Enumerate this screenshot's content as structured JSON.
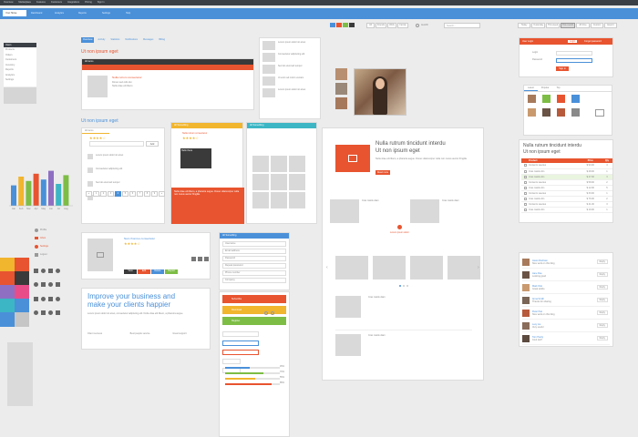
{
  "topbar": {
    "links": [
      "Overview",
      "Marketplace",
      "Features",
      "Customers",
      "Integrations",
      "Pricing",
      "Sign In"
    ],
    "tabs": [
      "Your Home",
      "Dashboard",
      "Analytics",
      "Reports",
      "Settings",
      "Help"
    ],
    "search_placeholder": "Search...",
    "small_buttons": [
      "All",
      "Friends",
      "Work",
      "Family"
    ],
    "right_tabs": [
      "Today",
      "Yesterday",
      "This week",
      "This month",
      "All time",
      "Custom",
      "Export"
    ]
  },
  "sidebar": {
    "items": [
      "Users",
      "Products",
      "Orders",
      "Customers",
      "Inventory",
      "Reports",
      "Analytics",
      "Settings"
    ]
  },
  "chart_labels": [
    "Jan",
    "Feb",
    "Mar",
    "Apr",
    "May",
    "Jun",
    "Jul",
    "Aug"
  ],
  "content_tabs": [
    "Overview",
    "Activity",
    "Statistics",
    "Notifications",
    "Messages",
    "Billing"
  ],
  "section_title": "Ut non ipsum eget",
  "section_title2": "Ut non ipsum eget",
  "widget_header": "All items",
  "reviews_tab": "All items",
  "product": {
    "name": "Nulla rutrum consectetur",
    "lines": [
      "Donec sed odio dui",
      "Nulla vitae elit libero",
      "Aenean lacinia bibendum"
    ]
  },
  "list_items": [
    "Lorem ipsum dolor sit amet",
    "Consectetur adipiscing elit",
    "Sed do eiusmod tempor",
    "Ut enim ad minim veniam"
  ],
  "add_button": "Add",
  "pagination": [
    "«",
    "1",
    "2",
    "3",
    "4",
    "5",
    "6",
    "7",
    "8",
    "9",
    "»"
  ],
  "vendor": {
    "name": "Nam rhoncus consectetur",
    "actions": [
      "View",
      "Edit",
      "Delete",
      "Report"
    ]
  },
  "promo": {
    "headline": "Improve your business and make your clients happier",
    "body": "Lorem ipsum dolor sit amet, consectetur adipiscing elit. Nulla vitae elit libero, a pharetra augue.",
    "columns": [
      "Client success",
      "Best people service",
      "Great support"
    ]
  },
  "notice_header": "All Something",
  "notice_header2": "All Something",
  "notice_text": "Nulla rutrum consectetur",
  "popup_title": "Hello there",
  "orange_note": "Nulla vitae elit libero, a pharetra augue. Donec ullamcorper nulla non metus auctor fringilla.",
  "form_header": "All Something",
  "form_fields": [
    "Username",
    "Email address",
    "Password",
    "Repeat password",
    "Phone number",
    "Company"
  ],
  "colored_buttons": [
    "Subscribe",
    "Download",
    "Register"
  ],
  "mid_panel": {
    "title": "Nulla rutrum tincidunt interdu",
    "subtitle": "Ut non ipsum eget",
    "link": "Read more"
  },
  "mid_items": [
    "Cras mattis diam",
    "Cras mattis diam",
    "Cras mattis diam",
    "Cras mattis diam"
  ],
  "center_label": "Lorem ipsum dolor",
  "login": {
    "title": "User Login",
    "tab1": "Login",
    "tab2": "Forgot password",
    "user_label": "Login",
    "pass_label": "Password",
    "button": "Sign in"
  },
  "social_tabs": [
    "Latest",
    "Popular",
    "Top"
  ],
  "table_panel": {
    "title": "Nulla rutrum tincidunt interdu",
    "subtitle": "Ut non ipsum eget",
    "headers": [
      "",
      "Product",
      "Price",
      "Qty"
    ],
    "rows": [
      [
        "Contents saucies",
        "$ 93.00",
        "4"
      ],
      [
        "Cras mattis dim",
        "$ 28.00",
        "1"
      ],
      [
        "Cras mattis dim",
        "$ 47.00",
        "3"
      ],
      [
        "Contents saucies",
        "$ 58.00",
        "2"
      ],
      [
        "Cras mattis dim",
        "$ 12.00",
        "5"
      ],
      [
        "Contents saucies",
        "$ 33.00",
        "1"
      ],
      [
        "Cras mattis dim",
        "$ 76.00",
        "2"
      ],
      [
        "Contents saucies",
        "$ 41.00",
        "3"
      ],
      [
        "Cras mattis dim",
        "$ 19.00",
        "1"
      ]
    ]
  },
  "comments": [
    {
      "name": "Jason Rodman",
      "text": "Nice work on this blog"
    },
    {
      "name": "Jane Doe",
      "text": "Looking good"
    },
    {
      "name": "Mark Otto",
      "text": "Great article"
    },
    {
      "name": "Anna Smith",
      "text": "Thanks for sharing"
    },
    {
      "name": "Peter Pan",
      "text": "Nice work on this blog"
    },
    {
      "name": "Lucy Liu",
      "text": "Very useful"
    },
    {
      "name": "Tom Hardy",
      "text": "Cool stuff"
    }
  ],
  "reply_button": "Reply",
  "progress": {
    "values": [
      0.45,
      0.7,
      0.55,
      0.85
    ],
    "labels": [
      "45%",
      "70%",
      "55%",
      "85%"
    ]
  },
  "bars": {
    "values": [
      28,
      40,
      34,
      44,
      36,
      48,
      30,
      42
    ],
    "colors": [
      "#4a90d9",
      "#f1b52e",
      "#7dbd45",
      "#e8542f",
      "#4a90d9",
      "#8e6fc2",
      "#3cb6c4",
      "#7dbd45"
    ]
  },
  "palette": [
    "#3a3a3a",
    "#e8542f",
    "#f1b52e",
    "#7dbd45",
    "#4a90d9",
    "#8e6fc2",
    "#3cb6c4",
    "#e84d8a",
    "#ff9e2c",
    "#c6c6c6"
  ],
  "accent": "#e8542f"
}
